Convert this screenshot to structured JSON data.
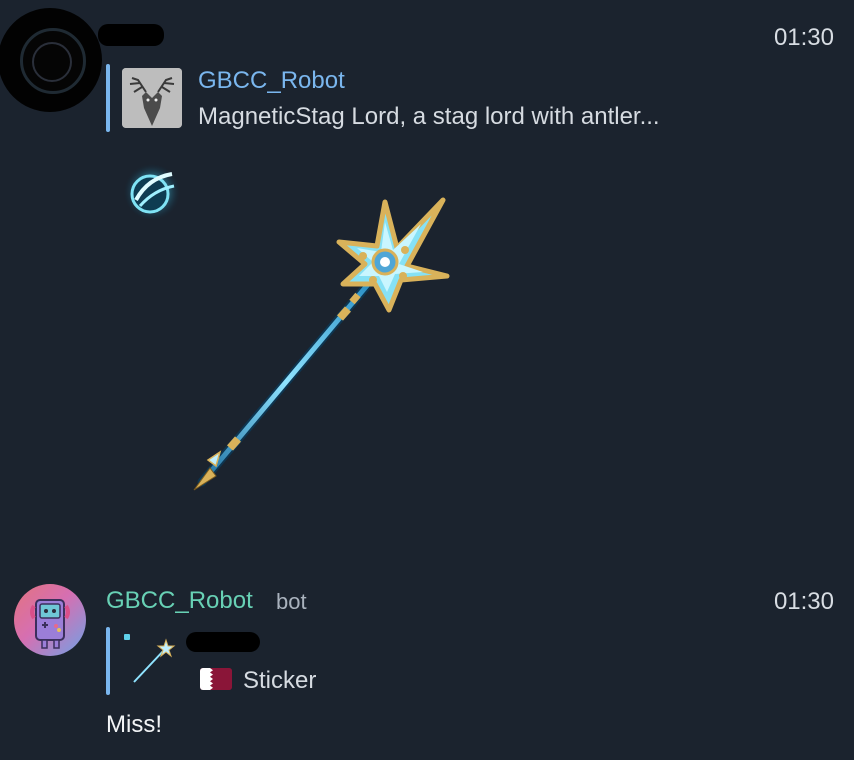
{
  "message1": {
    "time": "01:30",
    "reply": {
      "name": "GBCC_Robot",
      "text": "MagneticStag Lord, a stag lord with antler..."
    }
  },
  "message2": {
    "sender": "GBCC_Robot",
    "bot_tag": "bot",
    "time": "01:30",
    "reply": {
      "flag_icon": "qatar-flag-icon",
      "text": "Sticker"
    },
    "text": "Miss!"
  },
  "colors": {
    "background": "#1b232e",
    "reply_accent": "#7ab6ee",
    "bot_name": "#68d1b5"
  }
}
